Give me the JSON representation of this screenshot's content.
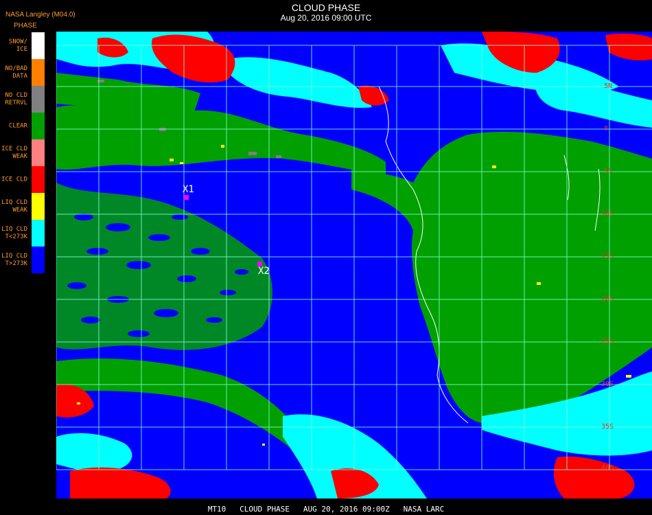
{
  "header": {
    "title": "CLOUD PHASE",
    "timestamp": "Aug 20, 2016 09:00 UTC",
    "org": "NASA Langley (M04.0)"
  },
  "legend": {
    "title": "PHASE",
    "items": [
      {
        "label": "SNOW/\nICE",
        "color": "#ffffff"
      },
      {
        "label": "NO/BAD\nDATA",
        "color": "#ff8000"
      },
      {
        "label": "NO CLD\nRETRVL",
        "color": "#808080"
      },
      {
        "label": "CLEAR",
        "color": "#00a000"
      },
      {
        "label": "ICE CLD\nWEAK",
        "color": "#ff8080"
      },
      {
        "label": "ICE CLD",
        "color": "#ff0000"
      },
      {
        "label": "LIQ CLD\nWEAK",
        "color": "#ffff00"
      },
      {
        "label": "LIQ CLD\nT<273K",
        "color": "#00ffff"
      },
      {
        "label": "LIQ CLD\nT>273K",
        "color": "#0000ff"
      }
    ]
  },
  "markers": [
    {
      "label": "X1"
    },
    {
      "label": "X2"
    }
  ],
  "grid_labels": [
    "5N",
    "0",
    "5S",
    "10S",
    "15S",
    "20S",
    "25S",
    "30S",
    "35S",
    "40S"
  ],
  "footer": "MT10   CLOUD PHASE   AUG 20, 2016 09:00Z   NASA LARC",
  "colors": {
    "ocean_liquid": "#0000ff",
    "land_clear": "#00a000",
    "ice": "#ff0000",
    "liquid_cold": "#00ffff",
    "grid": "#7fffd4",
    "legend_text": "#ff9a30"
  }
}
